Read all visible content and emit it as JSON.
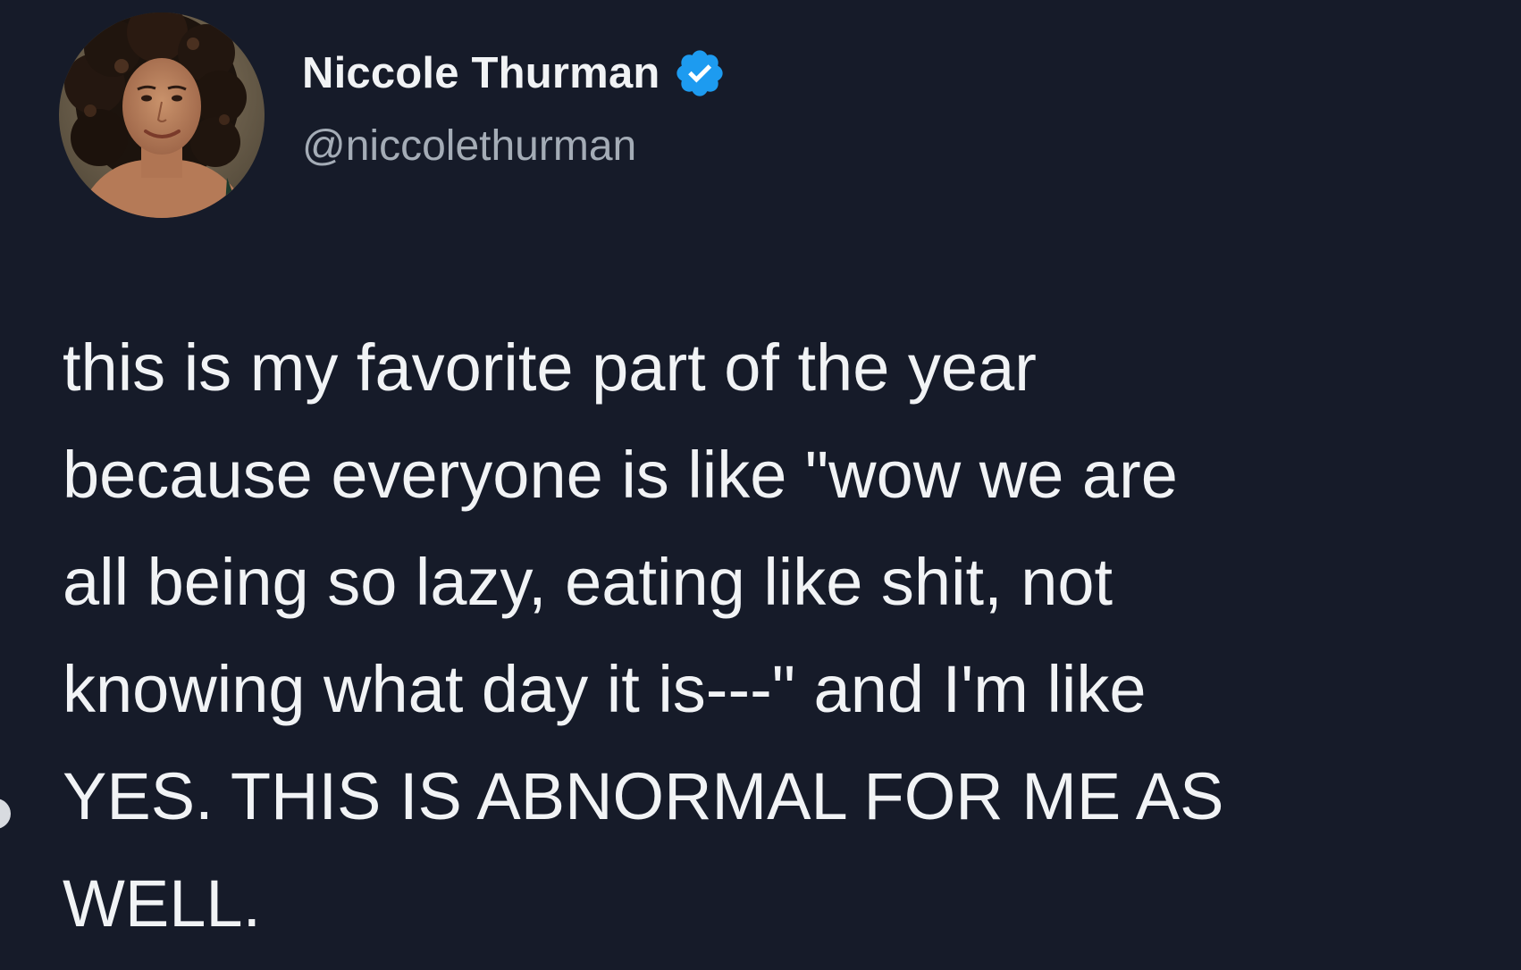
{
  "author": {
    "display_name": "Niccole Thurman",
    "handle": "@niccolethurman",
    "verified_icon": "verified-badge-icon",
    "avatar": "profile-photo"
  },
  "tweet": {
    "text": "this is my favorite part of the year\nbecause everyone is like \"wow we are\nall being so lazy, eating like shit, not\nknowing what day it is---\" and I'm like\nYES. THIS IS ABNORMAL FOR ME AS\nWELL."
  },
  "colors": {
    "background": "#161b29",
    "text": "#f1f3f5",
    "handle": "#a4acb6",
    "verified": "#1d9bf0"
  }
}
